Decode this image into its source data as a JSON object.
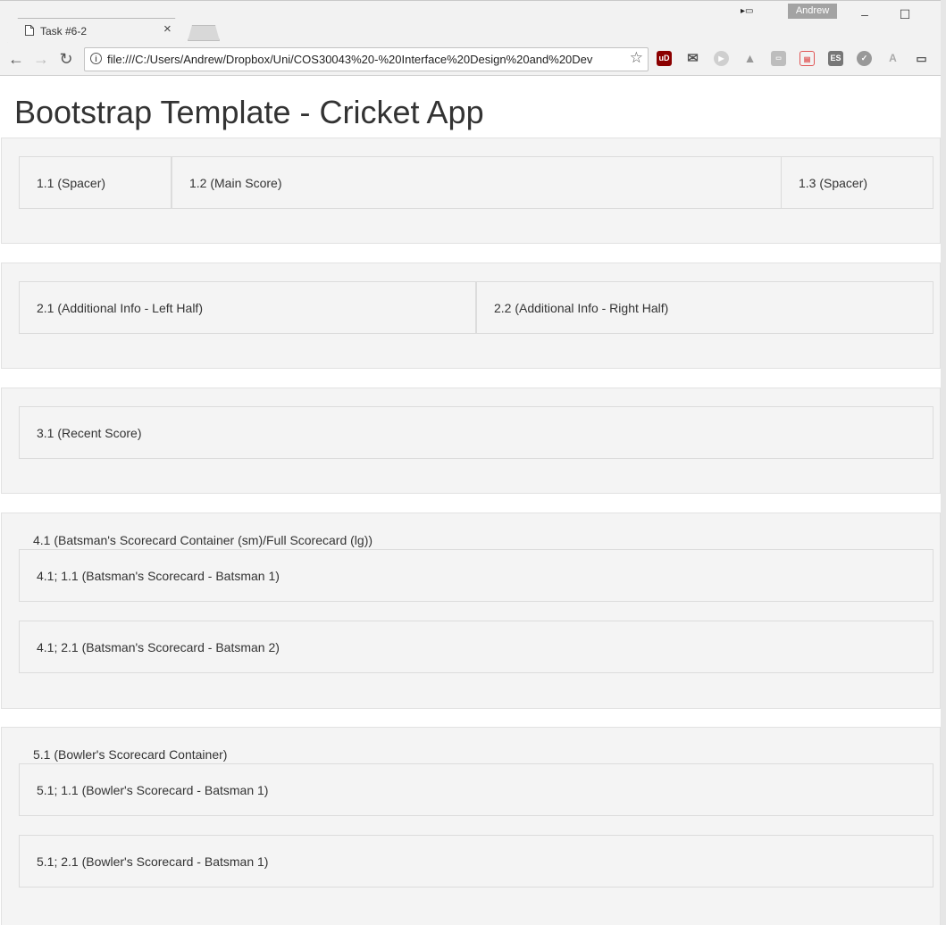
{
  "browser": {
    "tab_title": "Task #6-2",
    "tab_close": "×",
    "profile_name": "Andrew",
    "minimize": "–",
    "maximize": "☐",
    "url": "file:///C:/Users/Andrew/Dropbox/Uni/COS30043%20-%20Interface%20Design%20and%20Dev",
    "back": "←",
    "forward": "→",
    "reload": "↻",
    "info": "i",
    "star": "☆"
  },
  "page": {
    "title": "Bootstrap Template - Cricket App",
    "row1": {
      "col1": "1.1 (Spacer)",
      "col2": "1.2 (Main Score)",
      "col3": "1.3 (Spacer)"
    },
    "row2": {
      "col1": "2.1 (Additional Info - Left Half)",
      "col2": "2.2 (Additional Info - Right Half)"
    },
    "row3": {
      "col1": "3.1 (Recent Score)"
    },
    "row4": {
      "label": "4.1 (Batsman's Scorecard Container (sm)/Full Scorecard (lg))",
      "item1": "4.1; 1.1 (Batsman's Scorecard - Batsman 1)",
      "item2": "4.1; 2.1 (Batsman's Scorecard - Batsman 2)"
    },
    "row5": {
      "label": "5.1 (Bowler's Scorecard Container)",
      "item1": "5.1; 1.1 (Bowler's Scorecard - Batsman 1)",
      "item2": "5.1; 2.1 (Bowler's Scorecard - Batsman 1)"
    }
  },
  "extensions": [
    "ublock-origin-icon",
    "mail-icon",
    "play-icon",
    "drive-icon",
    "pdf-icon",
    "screenshot-icon",
    "es-icon",
    "extension-icon",
    "angular-icon",
    "cast-icon"
  ]
}
